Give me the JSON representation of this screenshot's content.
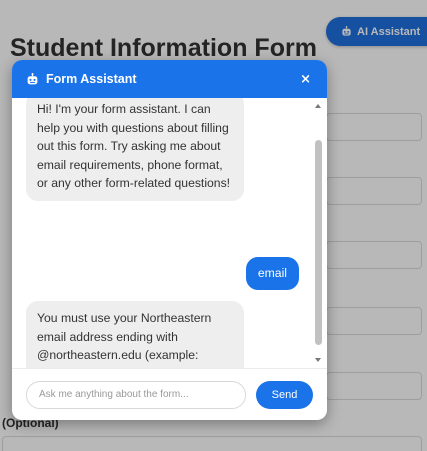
{
  "page": {
    "title": "Student Information Form",
    "optional_label": "(Optional)"
  },
  "ai_button": {
    "label": "AI Assistant",
    "icon": "robot-icon"
  },
  "chat": {
    "title": "Form Assistant",
    "header_icon": "robot-icon",
    "close_label": "×",
    "messages": [
      {
        "role": "bot",
        "text": "Hi! I'm your form assistant. I can help you with questions about filling out this form. Try asking me about email requirements, phone format, or any other form-related questions!"
      },
      {
        "role": "user",
        "text": "email"
      },
      {
        "role": "bot",
        "text": "You must use your Northeastern email address ending with @northeastern.edu (example: student@northeastern.edu). Other email domains are not accepted."
      }
    ],
    "input": {
      "value": "",
      "placeholder": "Ask me anything about the form..."
    },
    "send_label": "Send"
  },
  "colors": {
    "header": "#1a73e8",
    "user_bubble": "#1a73e8",
    "bot_bubble": "#eeeeee"
  }
}
